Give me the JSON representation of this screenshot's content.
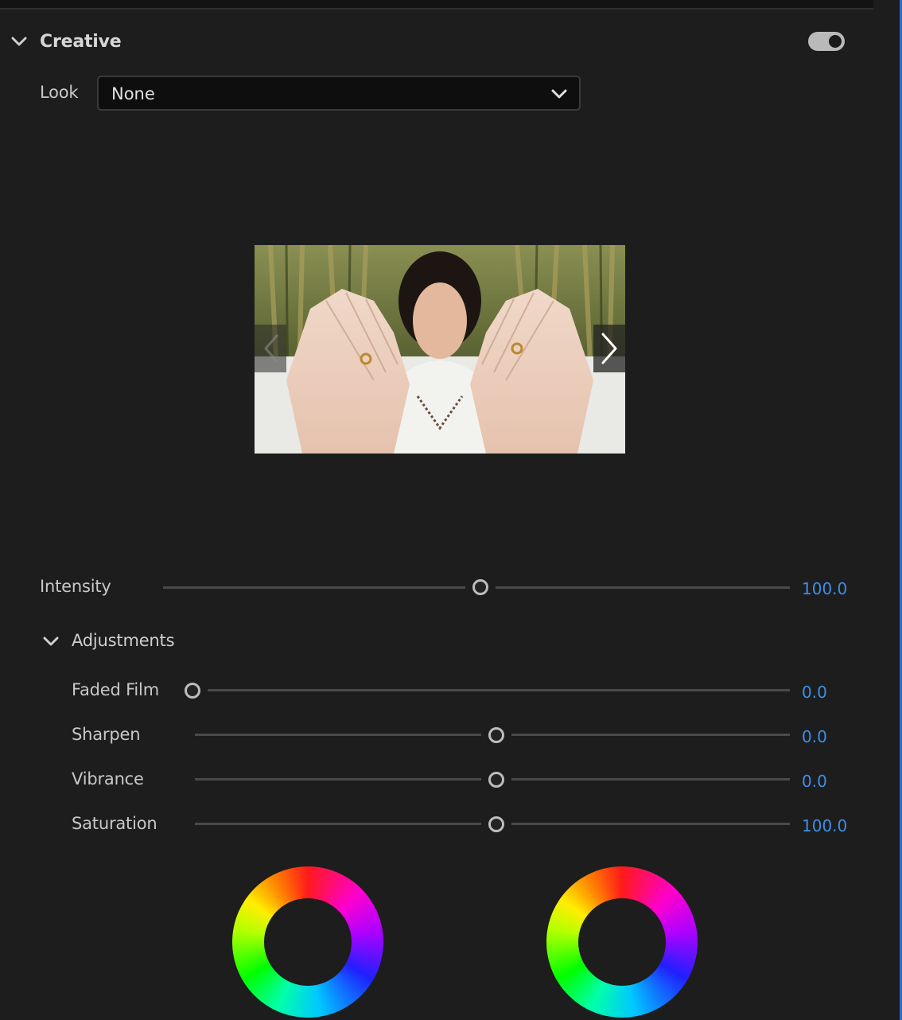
{
  "creative": {
    "title": "Creative",
    "enabled": true,
    "look_label": "Look",
    "look_value": "None"
  },
  "preview": {
    "prev_icon": "chevron-left-icon",
    "next_icon": "chevron-right-icon"
  },
  "intensity": {
    "label": "Intensity",
    "value": "100.0",
    "level": 0.5
  },
  "adjustments": {
    "title": "Adjustments",
    "sliders": [
      {
        "label": "Faded Film",
        "value": "0.0",
        "level": 0.0
      },
      {
        "label": "Sharpen",
        "value": "0.0",
        "level": 0.5
      },
      {
        "label": "Vibrance",
        "value": "0.0",
        "level": 0.5
      },
      {
        "label": "Saturation",
        "value": "100.0",
        "level": 0.5
      }
    ]
  },
  "colors": {
    "value_blue": "#3d8ee8",
    "accent": "#2a6bd1"
  },
  "color_wheels": [
    "shadow-tint-wheel",
    "highlight-tint-wheel"
  ]
}
